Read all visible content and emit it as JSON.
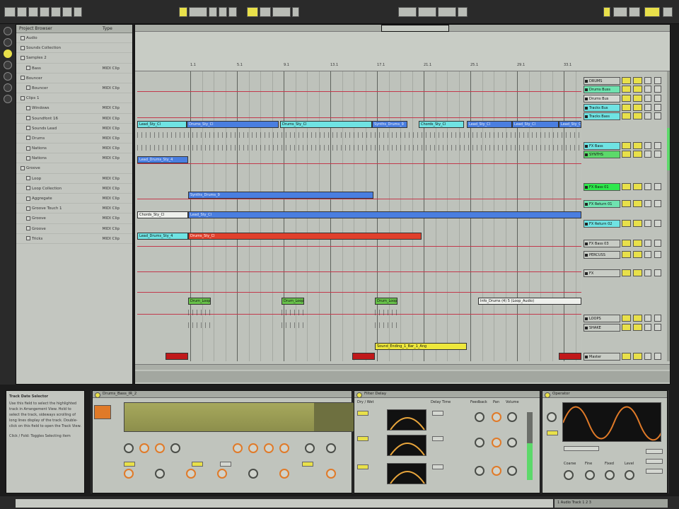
{
  "browser": {
    "header": "Project Browser",
    "type_label": "Type",
    "rows": [
      {
        "name": "Audio",
        "type": ""
      },
      {
        "name": "Sounds Collection",
        "type": ""
      },
      {
        "name": "Samples 2",
        "type": ""
      },
      {
        "name": "Bass",
        "type": "MIDI Clip"
      },
      {
        "name": "Bouncer",
        "type": ""
      },
      {
        "name": "Bouncer",
        "type": "MIDI Clip"
      },
      {
        "name": "Clips 1",
        "type": ""
      },
      {
        "name": "Windows",
        "type": "MIDI Clip"
      },
      {
        "name": "Soundfont 16",
        "type": "MIDI Clip"
      },
      {
        "name": "Sounds Lead",
        "type": "MIDI Clip"
      },
      {
        "name": "Drums",
        "type": "MIDI Clip"
      },
      {
        "name": "Nations",
        "type": "MIDI Clip"
      },
      {
        "name": "Nations",
        "type": "MIDI Clip"
      },
      {
        "name": "Groove",
        "type": ""
      },
      {
        "name": "Loop",
        "type": "MIDI Clip"
      },
      {
        "name": "Loop Collection",
        "type": "MIDI Clip"
      },
      {
        "name": "Aggregate",
        "type": "MIDI Clip"
      },
      {
        "name": "Groove Touch 1",
        "type": "MIDI Clip"
      },
      {
        "name": "Groove",
        "type": "MIDI Clip"
      },
      {
        "name": "Groove",
        "type": "MIDI Clip"
      },
      {
        "name": "Tricks",
        "type": "MIDI Clip"
      }
    ]
  },
  "ruler": {
    "bars": [
      "1.1",
      "5.1",
      "9.1",
      "13.1",
      "17.1",
      "21.1",
      "25.1",
      "29.1",
      "33.1"
    ]
  },
  "clips": {
    "lead": "Lead_Sty_Cl",
    "pad1": "Drums_Sty_Cl",
    "pad2": "Drums_Sty_Cl",
    "chord1": "Synths_Drums_9",
    "chord2": "Chords_Sty_Cl",
    "blue_main": "Lead_Sty_Cl",
    "red_left": "Lead_Drums_Sty_4",
    "red_main": "Drums_Sty_Cl",
    "green1": "Drum_Loop",
    "green2": "Drum_Loop",
    "green3": "Drum_Loop",
    "info_clip": "Info_Drums (4) 5 (Loop_Audio)",
    "yellow": "Sound_Ending_1_Bar_1_Ang"
  },
  "tracks": [
    {
      "name": "DRUMS",
      "color": "#c8ccc5"
    },
    {
      "name": "Drums Buss",
      "color": "#6fe3b0"
    },
    {
      "name": "Drums Bus",
      "color": "#d6d8d3"
    },
    {
      "name": "Tracks Bus",
      "color": "#6fe3e3"
    },
    {
      "name": "Tracks Bass",
      "color": "#6fe3e3"
    },
    {
      "name": "FX Bass",
      "color": "#6fe3e3"
    },
    {
      "name": "SYNTHS",
      "color": "#5cd96a"
    },
    {
      "name": "FX Bass 01",
      "color": "#2ee84c"
    },
    {
      "name": "FX Return 01",
      "color": "#6fe3b0"
    },
    {
      "name": "FX Return 02",
      "color": "#6fe3e3"
    },
    {
      "name": "FX Bass 03",
      "color": "#c8ccc5"
    },
    {
      "name": "PERCUSS",
      "color": "#c8ccc5"
    },
    {
      "name": "FX",
      "color": "#c8ccc5"
    },
    {
      "name": "LOOPS",
      "color": "#c8ccc5"
    },
    {
      "name": "SHAKE",
      "color": "#c8ccc5"
    },
    {
      "name": "Master",
      "color": "#c8ccc5"
    }
  ],
  "info": {
    "title": "Track Date Selector",
    "body": "Use this field to select the highlighted track in Arrangement View. Hold to select the track, sideways scrolling of long lines display of the track. Double-click on this field to open the Track View.",
    "hint": "Click / Fold: Toggles Selecting item"
  },
  "devices": {
    "d1_title": "Drums_Bass_IR_2",
    "d2_title": "Filter Delay",
    "d3_title": "Operator",
    "d2_labels": [
      "Dry / Wet",
      "Delay Time",
      "Feedback",
      "Pan",
      "Volume"
    ],
    "d3_labels": [
      "Coarse",
      "Fine",
      "Fixed",
      "Level"
    ]
  },
  "status": {
    "right": "1 Audio Track 1 2 3"
  }
}
